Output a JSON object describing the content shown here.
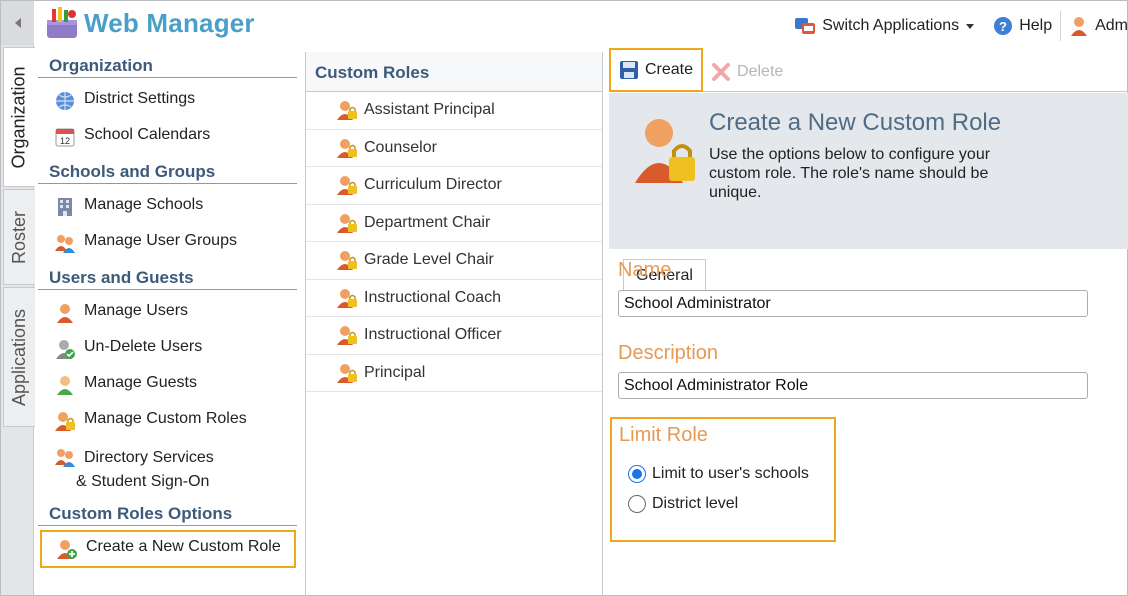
{
  "app": {
    "title": "Web Manager"
  },
  "header": {
    "switch_label": "Switch Applications",
    "help_label": "Help",
    "user_label": "Adm"
  },
  "vtabs": [
    {
      "label": "Organization",
      "active": true
    },
    {
      "label": "Roster",
      "active": false
    },
    {
      "label": "Applications",
      "active": false
    }
  ],
  "nav": {
    "groups": [
      {
        "title": "Organization",
        "items": [
          "District Settings",
          "School Calendars"
        ]
      },
      {
        "title": "Schools and Groups",
        "items": [
          "Manage Schools",
          "Manage User Groups"
        ]
      },
      {
        "title": "Users and Guests",
        "items": [
          "Manage Users",
          "Un-Delete Users",
          "Manage Guests",
          "Manage Custom Roles",
          "Directory Services",
          "& Student Sign-On"
        ]
      },
      {
        "title": "Custom Roles Options",
        "items": [
          "Create a New Custom Role"
        ]
      }
    ]
  },
  "list": {
    "header": "Custom Roles",
    "rows": [
      "Assistant Principal",
      "Counselor",
      "Curriculum Director",
      "Department Chair",
      "Grade Level Chair",
      "Instructional Coach",
      "Instructional Officer",
      "Principal"
    ]
  },
  "toolbar": {
    "create_label": "Create",
    "delete_label": "Delete"
  },
  "hero": {
    "title": "Create a New Custom Role",
    "description": "Use the options below to configure your custom role. The role's name should be unique."
  },
  "tabs": {
    "general": "General"
  },
  "form": {
    "name_label": "Name",
    "name_value": "School Administrator",
    "description_label": "Description",
    "description_value": "School Administrator Role",
    "limit_label": "Limit Role",
    "limit_options": [
      "Limit to user's schools",
      "District level"
    ],
    "limit_selected": "Limit to user's schools"
  },
  "colors": {
    "accent_highlight": "#f0a81a",
    "label_orange": "#e59a55",
    "group_blue": "#3c5a7a",
    "logo_blue": "#4a9fc8"
  }
}
